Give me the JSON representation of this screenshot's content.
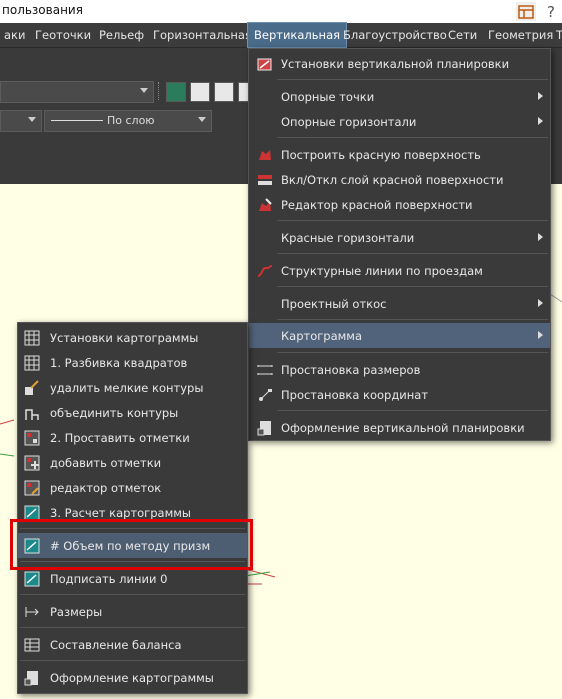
{
  "window": {
    "title": "пользования"
  },
  "menubar": {
    "items": [
      {
        "label": "аки"
      },
      {
        "label": "Геоточки"
      },
      {
        "label": "Рельеф"
      },
      {
        "label": "Горизонтальная"
      },
      {
        "label": "Вертикальная"
      },
      {
        "label": "Благоустройство"
      },
      {
        "label": "Сети"
      },
      {
        "label": "Геометрия"
      },
      {
        "label": "Т"
      }
    ]
  },
  "toolbar": {
    "linetype_combo": "По слою"
  },
  "vertical_menu": {
    "items": [
      {
        "label": "Установки вертикальной планировки"
      },
      {
        "label": "Опорные точки"
      },
      {
        "label": "Опорные горизонтали"
      },
      {
        "label": "Построить красную поверхность"
      },
      {
        "label": "Вкл/Откл слой красной поверхности"
      },
      {
        "label": "Редактор красной поверхности"
      },
      {
        "label": "Красные горизонтали"
      },
      {
        "label": "Структурные линии по проездам"
      },
      {
        "label": "Проектный откос"
      },
      {
        "label": "Картограмма"
      },
      {
        "label": "Простановка размеров"
      },
      {
        "label": "Простановка координат"
      },
      {
        "label": "Оформление вертикальной планировки"
      }
    ]
  },
  "kartogramma_menu": {
    "items": [
      {
        "label": "Установки картограммы"
      },
      {
        "label": "1. Разбивка квадратов"
      },
      {
        "label": "удалить мелкие контуры"
      },
      {
        "label": "объединить контуры"
      },
      {
        "label": "2. Проставить отметки"
      },
      {
        "label": "добавить отметки"
      },
      {
        "label": "редактор отметок"
      },
      {
        "label": "3. Расчет картограммы"
      },
      {
        "label": "# Объем по методу призм"
      },
      {
        "label": "Подписать линии 0"
      },
      {
        "label": "Размеры"
      },
      {
        "label": "Составление баланса"
      },
      {
        "label": "Оформление картограммы"
      }
    ]
  },
  "colors": {
    "accent": "#4a6b8a",
    "highlight_box": "#e00000",
    "canvas": "#ffffe6"
  }
}
